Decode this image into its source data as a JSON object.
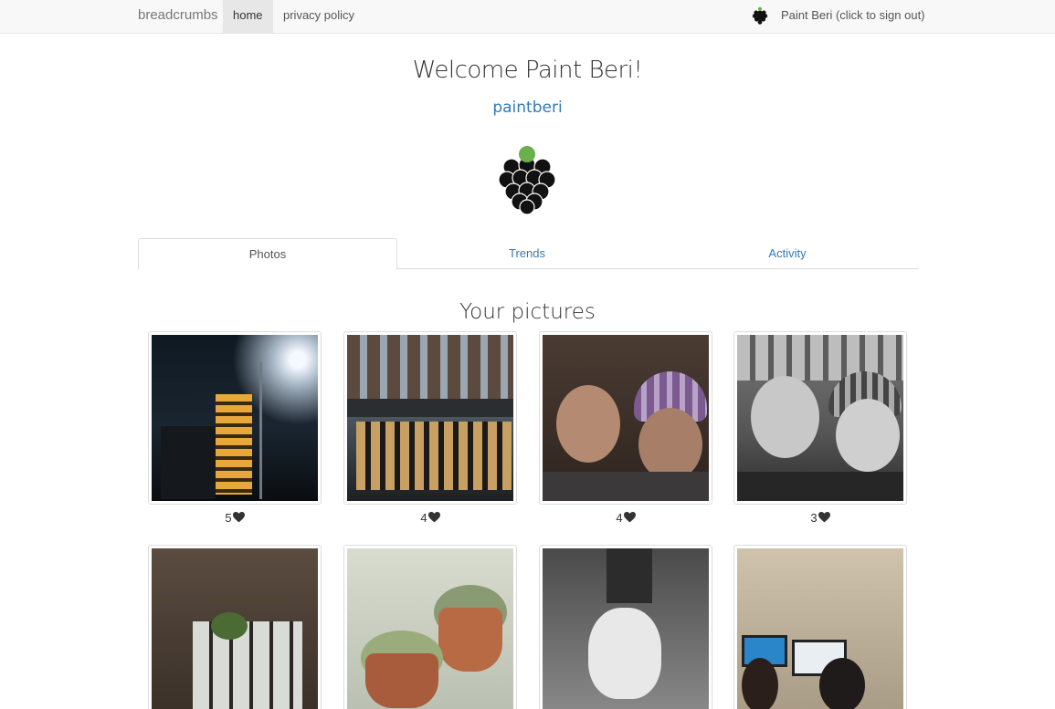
{
  "navbar": {
    "brand": "breadcrumbs",
    "items": [
      {
        "label": "home",
        "active": true
      },
      {
        "label": "privacy policy",
        "active": false
      }
    ],
    "user_link": "Paint Beri (click to sign out)"
  },
  "profile": {
    "welcome": "Welcome Paint Beri!",
    "username": "paintberi"
  },
  "tabs": [
    {
      "label": "Photos",
      "active": true
    },
    {
      "label": "Trends",
      "active": false
    },
    {
      "label": "Activity",
      "active": false
    }
  ],
  "section_title": "Your pictures",
  "photos": [
    {
      "likes": "5",
      "subject": "night building with streetlight"
    },
    {
      "likes": "4",
      "subject": "modern building storefront"
    },
    {
      "likes": "4",
      "subject": "selfie of two people in winter hats"
    },
    {
      "likes": "3",
      "subject": "black and white selfie of two people"
    },
    {
      "likes": "",
      "subject": "living room with large window"
    },
    {
      "likes": "",
      "subject": "succulents in pots"
    },
    {
      "likes": "",
      "subject": "white dog"
    },
    {
      "likes": "",
      "subject": "people at computers"
    }
  ],
  "colors": {
    "link": "#337ab7",
    "logo_stem": "#6ab04c",
    "logo_berries": "#111111"
  }
}
